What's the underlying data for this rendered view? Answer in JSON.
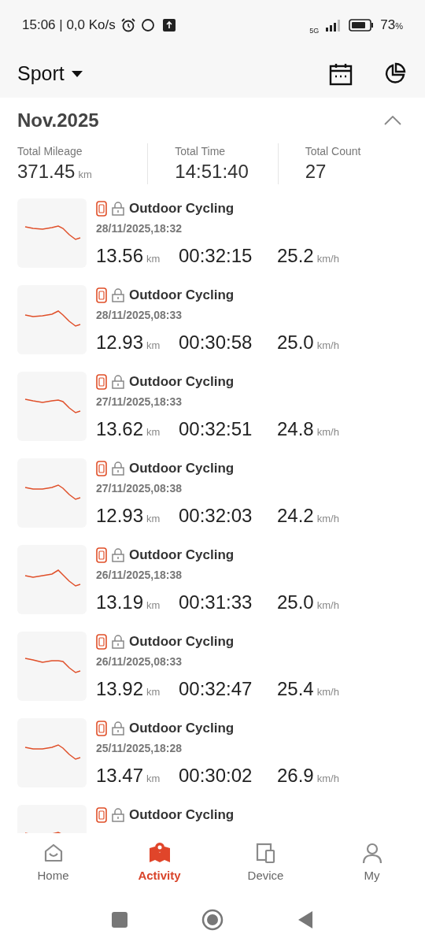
{
  "status_bar": {
    "time": "15:06 | 0,0 Ko/s",
    "network": "5G",
    "battery": "73",
    "battery_unit": "%"
  },
  "header": {
    "title": "Sport"
  },
  "month": {
    "title": "Nov.2025",
    "expanded": true
  },
  "summary": [
    {
      "label": "Total Mileage",
      "value": "371.45",
      "unit": "km"
    },
    {
      "label": "Total Time",
      "value": "14:51:40"
    },
    {
      "label": "Total Count",
      "value": "27"
    }
  ],
  "activities": [
    {
      "title": "Outdoor Cycling",
      "date": "28/11/2025,18:32",
      "distance": "13.56",
      "distance_unit": "km",
      "duration": "00:32:15",
      "speed": "25.2",
      "speed_unit": "km/h"
    },
    {
      "title": "Outdoor Cycling",
      "date": "28/11/2025,08:33",
      "distance": "12.93",
      "distance_unit": "km",
      "duration": "00:30:58",
      "speed": "25.0",
      "speed_unit": "km/h"
    },
    {
      "title": "Outdoor Cycling",
      "date": "27/11/2025,18:33",
      "distance": "13.62",
      "distance_unit": "km",
      "duration": "00:32:51",
      "speed": "24.8",
      "speed_unit": "km/h"
    },
    {
      "title": "Outdoor Cycling",
      "date": "27/11/2025,08:38",
      "distance": "12.93",
      "distance_unit": "km",
      "duration": "00:32:03",
      "speed": "24.2",
      "speed_unit": "km/h"
    },
    {
      "title": "Outdoor Cycling",
      "date": "26/11/2025,18:38",
      "distance": "13.19",
      "distance_unit": "km",
      "duration": "00:31:33",
      "speed": "25.0",
      "speed_unit": "km/h"
    },
    {
      "title": "Outdoor Cycling",
      "date": "26/11/2025,08:33",
      "distance": "13.92",
      "distance_unit": "km",
      "duration": "00:32:47",
      "speed": "25.4",
      "speed_unit": "km/h"
    },
    {
      "title": "Outdoor Cycling",
      "date": "25/11/2025,18:28",
      "distance": "13.47",
      "distance_unit": "km",
      "duration": "00:30:02",
      "speed": "26.9",
      "speed_unit": "km/h"
    },
    {
      "title": "Outdoor Cycling"
    }
  ],
  "bottom_nav": [
    {
      "label": "Home",
      "kind": "home",
      "selected": false
    },
    {
      "label": "Activity",
      "kind": "activity",
      "selected": true
    },
    {
      "label": "Device",
      "kind": "device",
      "selected": false
    },
    {
      "label": "My",
      "kind": "person",
      "selected": false
    }
  ]
}
